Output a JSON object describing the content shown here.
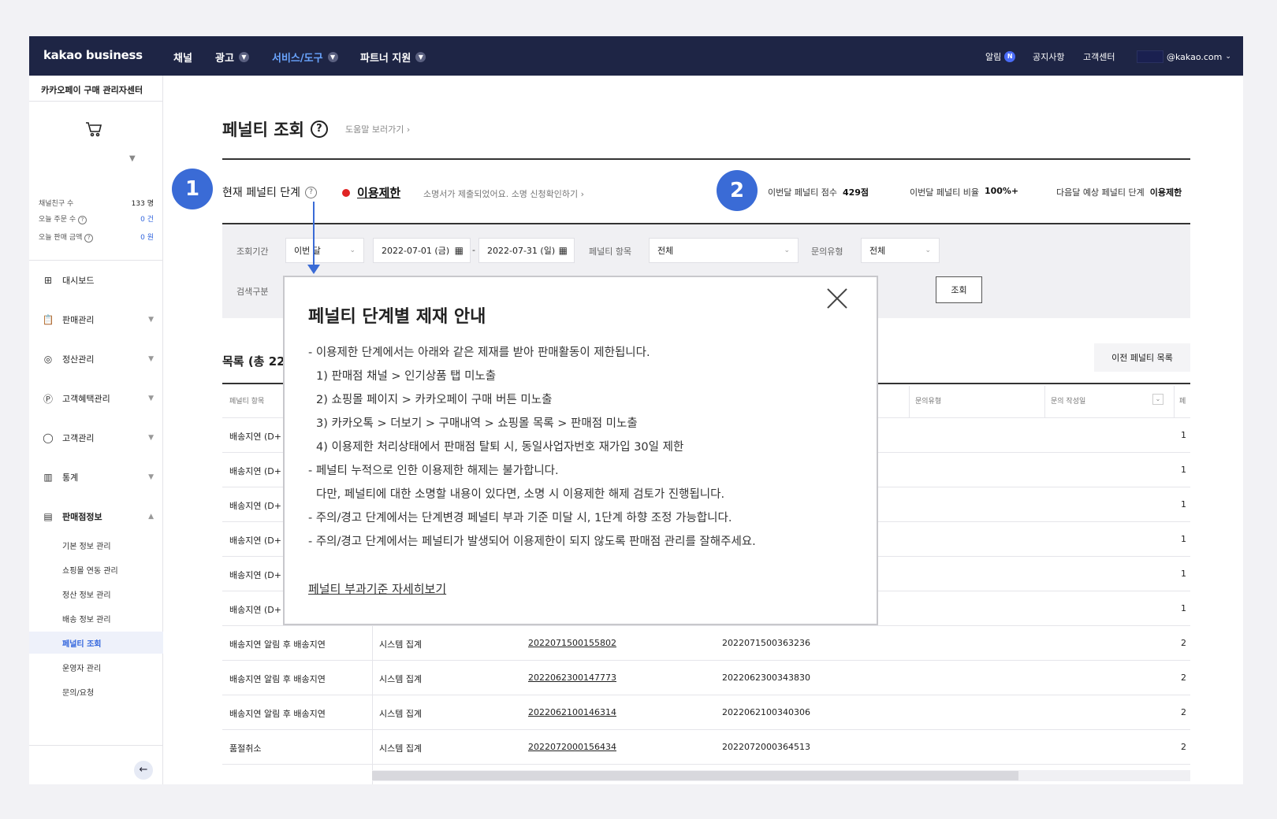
{
  "nav": {
    "logo": "kakao business",
    "items": [
      {
        "label": "채널",
        "chev": false
      },
      {
        "label": "광고",
        "chev": true
      },
      {
        "label": "서비스/도구",
        "chev": true,
        "active": true
      },
      {
        "label": "파트너 지원",
        "chev": true
      }
    ],
    "right": {
      "alarm": "알림",
      "alarm_badge": "N",
      "notice": "공지사항",
      "support": "고객센터",
      "email": "@kakao.com"
    }
  },
  "sidebar": {
    "title": "카카오페이 구매 관리자센터",
    "stats": [
      {
        "label": "채널친구 수",
        "value": "133 명",
        "help": false
      },
      {
        "label": "오늘 주문 수",
        "value": "0 건",
        "help": true
      },
      {
        "label": "오늘 판매 금액",
        "value": "0 원",
        "help": true
      }
    ],
    "menu": [
      {
        "label": "대시보드",
        "icon": "dashboard-icon"
      },
      {
        "label": "판매관리",
        "icon": "clipboard-icon"
      },
      {
        "label": "정산관리",
        "icon": "coins-icon"
      },
      {
        "label": "고객혜택관리",
        "icon": "points-icon"
      },
      {
        "label": "고객관리",
        "icon": "user-icon"
      },
      {
        "label": "통계",
        "icon": "bar-chart-icon"
      },
      {
        "label": "판매점정보",
        "icon": "store-icon"
      }
    ],
    "submenu": [
      "기본 정보 관리",
      "쇼핑몰 연동 관리",
      "정산 정보 관리",
      "배송 정보 관리",
      "페널티 조회",
      "운영자 관리",
      "문의/요청"
    ],
    "active_sub": "페널티 조회"
  },
  "page": {
    "title": "페널티 조회",
    "help_link": "도움말 보러가기",
    "stage_label": "현재 페널티 단계",
    "stage_value": "이용제한",
    "stage_note": "소명서가 제출되었어요. 소명 신청확인하기",
    "callouts": [
      "1",
      "2"
    ],
    "scores": {
      "month_score_label": "이번달 페널티 점수",
      "month_score": "429점",
      "month_rate_label": "이번달 페널티 비율",
      "month_rate": "100%+",
      "next_stage_label": "다음달 예상 페널티 단계",
      "next_stage": "이용제한"
    }
  },
  "filter": {
    "period_label": "조회기간",
    "period_value": "이번 달",
    "date_from": "2022-07-01 (금)",
    "date_sep": "-",
    "date_to": "2022-07-31 (일)",
    "item_label": "페널티 항목",
    "item_value": "전체",
    "inquiry_label": "문의유형",
    "inquiry_value": "전체",
    "search_type_label": "검색구분",
    "search_button": "조회"
  },
  "list": {
    "title": "목록 (총 22",
    "prev_button": "이전 페널티 목록",
    "headers": [
      "페널티 항목",
      "문의유형",
      "문의 작성일",
      "페"
    ],
    "rows": [
      {
        "item": "배송지연 (D+",
        "src": "",
        "order": "",
        "prod": "",
        "last": "1"
      },
      {
        "item": "배송지연 (D+",
        "src": "",
        "order": "",
        "prod": "",
        "last": "1"
      },
      {
        "item": "배송지연 (D+",
        "src": "",
        "order": "",
        "prod": "",
        "last": "1"
      },
      {
        "item": "배송지연 (D+",
        "src": "",
        "order": "",
        "prod": "",
        "last": "1"
      },
      {
        "item": "배송지연 (D+",
        "src": "",
        "order": "",
        "prod": "",
        "last": "1"
      },
      {
        "item": "배송지연 (D+",
        "src": "",
        "order": "",
        "prod": "",
        "last": "1"
      },
      {
        "item": "배송지연 알림 후 배송지연",
        "src": "시스템 집계",
        "order": "2022071500155802",
        "prod": "2022071500363236",
        "last": "2"
      },
      {
        "item": "배송지연 알림 후 배송지연",
        "src": "시스템 집계",
        "order": "2022062300147773",
        "prod": "2022062300343830",
        "last": "2"
      },
      {
        "item": "배송지연 알림 후 배송지연",
        "src": "시스템 집계",
        "order": "2022062100146314",
        "prod": "2022062100340306",
        "last": "2"
      },
      {
        "item": "품절취소",
        "src": "시스템 집계",
        "order": "2022072000156434",
        "prod": "2022072000364513",
        "last": "2"
      }
    ]
  },
  "modal": {
    "title": "페널티 단계별 제재 안내",
    "lines": [
      {
        "text": "- 이용제한 단계에서는 아래와 같은 제재를 받아 판매활동이 제한됩니다.",
        "indent": false
      },
      {
        "text": "1) 판매점 채널 > 인기상품 탭 미노출",
        "indent": true
      },
      {
        "text": "2) 쇼핑몰 페이지 > 카카오페이 구매 버튼 미노출",
        "indent": true
      },
      {
        "text": "3) 카카오톡 > 더보기 > 구매내역 > 쇼핑몰 목록 > 판매점 미노출",
        "indent": true
      },
      {
        "text": "4) 이용제한 처리상태에서 판매점 탈퇴 시, 동일사업자번호 재가입 30일 제한",
        "indent": true
      },
      {
        "text": "- 페널티 누적으로 인한 이용제한 해제는 불가합니다.",
        "indent": false
      },
      {
        "text": "다만, 페널티에 대한 소명할 내용이 있다면, 소명 시 이용제한 해제 검토가 진행됩니다.",
        "indent": true
      },
      {
        "text": "- 주의/경고 단계에서는 단계변경 페널티 부과 기준 미달 시, 1단계 하향 조정 가능합니다.",
        "indent": false
      },
      {
        "text": "- 주의/경고 단계에서는 페널티가 발생되어 이용제한이 되지 않도록 판매점 관리를 잘해주세요.",
        "indent": false
      }
    ],
    "link": "페널티 부과기준 자세히보기"
  }
}
